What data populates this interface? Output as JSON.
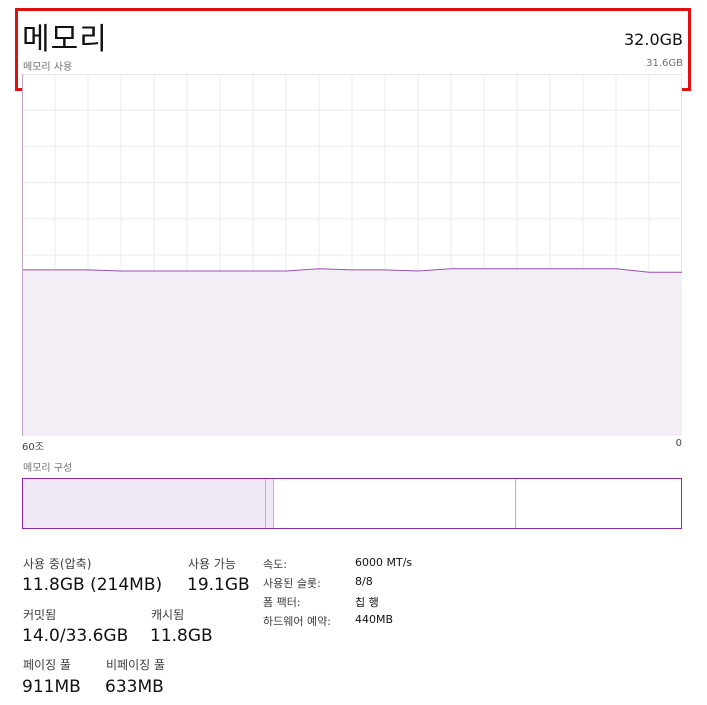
{
  "header": {
    "title": "메모리",
    "total": "32.0GB",
    "usage_label": "메모리 사용",
    "usage_max": "31.6GB"
  },
  "chart_data": {
    "type": "area",
    "xlabel": "",
    "ylabel": "",
    "x_left_label": "60조",
    "x_right_label": "0",
    "xlim": [
      60,
      0
    ],
    "ylim": [
      0,
      31.6
    ],
    "grid": true,
    "line_color": "#9a4fb5",
    "fill_color": "#f3eef6",
    "series": [
      {
        "x": [
          60,
          57,
          54,
          51,
          48,
          45,
          42,
          39,
          36,
          33,
          30,
          27,
          24,
          21,
          18,
          15,
          12,
          9,
          6,
          3,
          0
        ],
        "values": [
          14.5,
          14.5,
          14.5,
          14.4,
          14.4,
          14.4,
          14.4,
          14.4,
          14.4,
          14.6,
          14.5,
          14.5,
          14.4,
          14.6,
          14.6,
          14.6,
          14.6,
          14.6,
          14.6,
          14.3,
          14.3
        ]
      }
    ]
  },
  "composition": {
    "label": "메모리 구성",
    "segments": [
      {
        "name": "in-use",
        "value": 11.8,
        "fill": "#f1e8f5",
        "border": "#c9a6d8"
      },
      {
        "name": "modified",
        "value": 0.4,
        "fill": "#f1e8f5",
        "border": "#c9a6d8"
      },
      {
        "name": "standby",
        "value": 11.8,
        "fill": "#ffffff",
        "border": "#c9a6d8"
      },
      {
        "name": "free",
        "value": 8.0,
        "fill": "#ffffff",
        "border": "none"
      }
    ],
    "total": 32.0
  },
  "stats": {
    "in_use_label": "사용 중(압축)",
    "in_use_value": "11.8GB (214MB)",
    "available_label": "사용 가능",
    "available_value": "19.1GB",
    "committed_label": "커밋됨",
    "committed_value": "14.0/33.6GB",
    "cached_label": "캐시됨",
    "cached_value": "11.8GB",
    "paged_label": "페이징 풀",
    "paged_value": "911MB",
    "nonpaged_label": "비페이징 풀",
    "nonpaged_value": "633MB"
  },
  "specs": {
    "speed_label": "속도:",
    "speed_value": "6000 MT/s",
    "slots_label": "사용된 슬롯:",
    "slots_value": "8/8",
    "form_label": "폼 팩터:",
    "form_value": "칩 행",
    "reserved_label": "하드웨어 예약:",
    "reserved_value": "440MB"
  },
  "colors": {
    "highlight": "#e01010",
    "accent": "#8a2aa8"
  }
}
